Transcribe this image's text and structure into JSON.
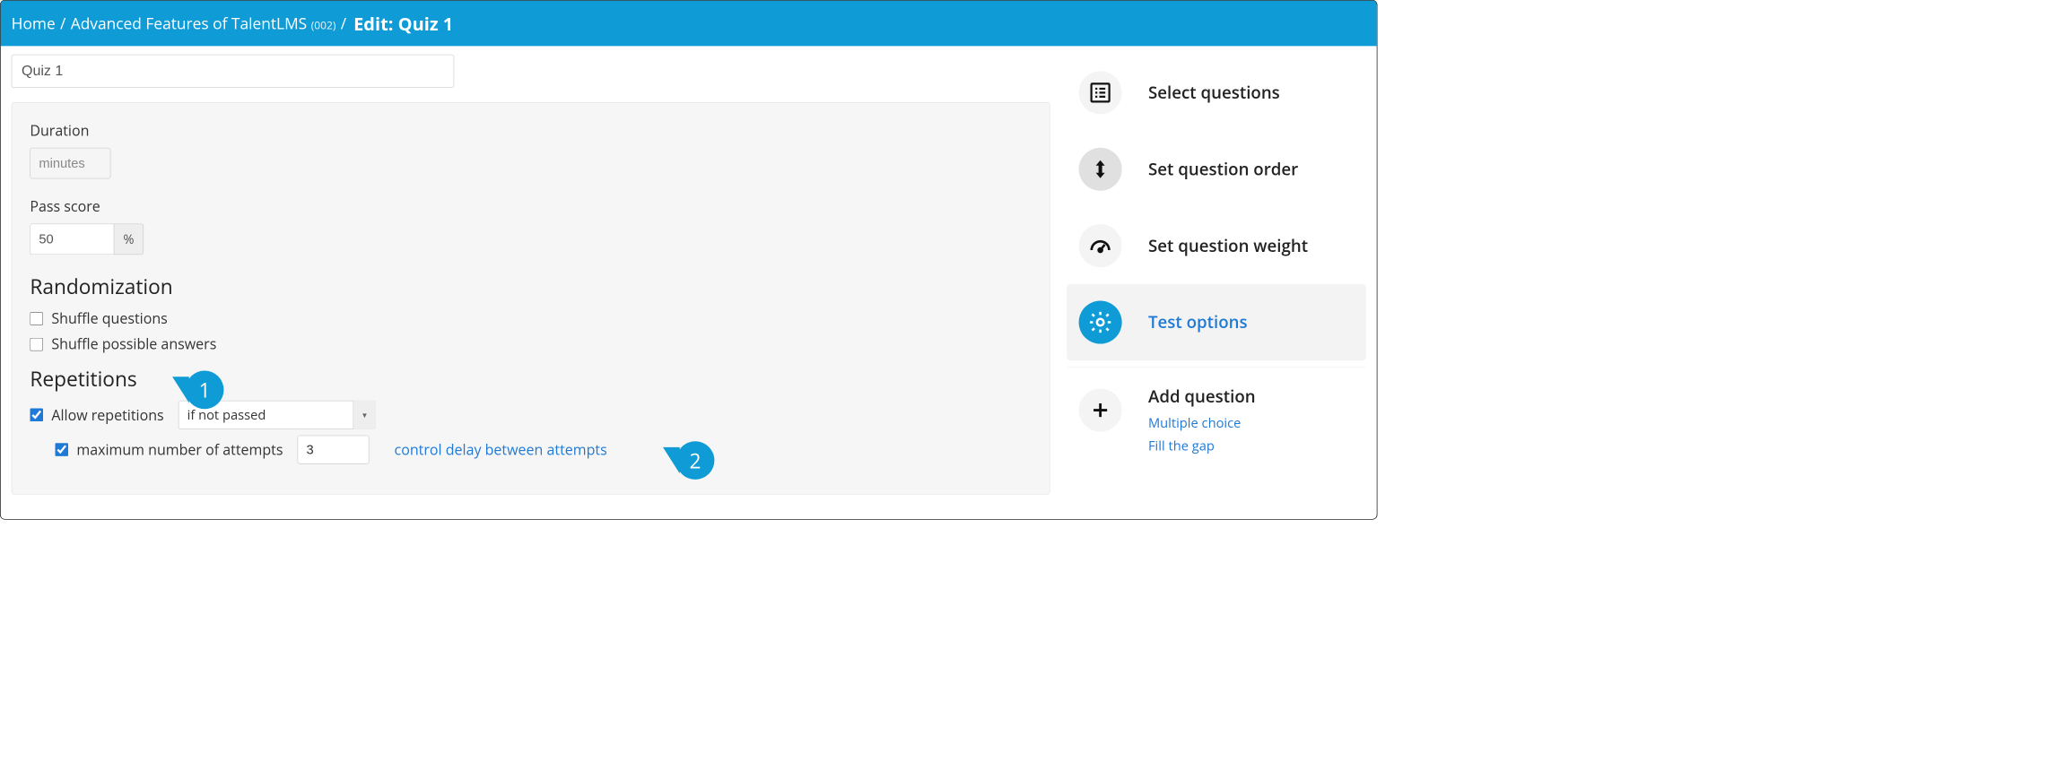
{
  "breadcrumb": {
    "home": "Home",
    "course": "Advanced Features of TalentLMS",
    "course_code": "(002)",
    "current": "Edit: Quiz 1"
  },
  "quiz": {
    "name": "Quiz 1"
  },
  "fields": {
    "duration_label": "Duration",
    "duration_placeholder": "minutes",
    "passscore_label": "Pass score",
    "passscore_value": "50",
    "passscore_unit": "%"
  },
  "randomization": {
    "heading": "Randomization",
    "shuffle_questions_label": "Shuffle questions",
    "shuffle_questions_checked": false,
    "shuffle_answers_label": "Shuffle possible answers",
    "shuffle_answers_checked": false
  },
  "repetitions": {
    "heading": "Repetitions",
    "allow_label": "Allow repetitions",
    "allow_checked": true,
    "condition_selected": "if not passed",
    "max_attempts_label": "maximum number of attempts",
    "max_attempts_checked": true,
    "max_attempts_value": "3",
    "delay_link": "control delay between attempts"
  },
  "callouts": {
    "one": "1",
    "two": "2"
  },
  "sidebar": {
    "select_questions": "Select questions",
    "set_order": "Set question order",
    "set_weight": "Set question weight",
    "test_options": "Test options",
    "add_question": "Add question",
    "multiple_choice": "Multiple choice",
    "fill_the_gap": "Fill the gap"
  }
}
